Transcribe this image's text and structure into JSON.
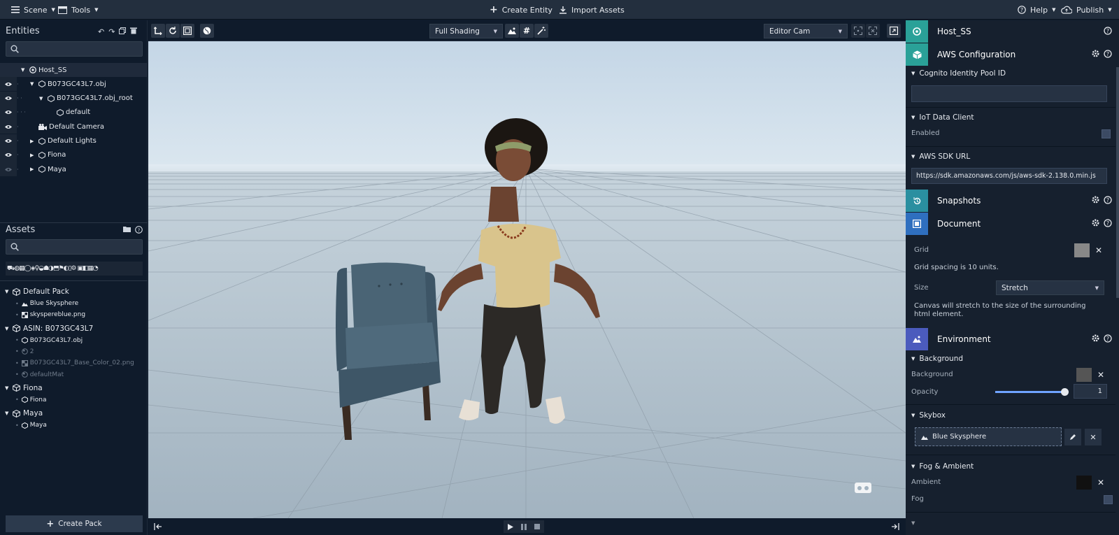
{
  "topbar": {
    "scene_label": "Scene",
    "tools_label": "Tools",
    "create_entity_label": "Create Entity",
    "import_assets_label": "Import Assets",
    "help_label": "Help",
    "publish_label": "Publish"
  },
  "entities": {
    "title": "Entities",
    "search_placeholder": "",
    "rows": [
      {
        "label": "Host_SS",
        "icon": "host-icon"
      },
      {
        "label": "B073GC43L7.obj",
        "icon": "mesh-icon"
      },
      {
        "label": "B073GC43L7.obj_root",
        "icon": "mesh-icon"
      },
      {
        "label": "default",
        "icon": "mesh-icon"
      },
      {
        "label": "Default Camera",
        "icon": "camera-icon"
      },
      {
        "label": "Default Lights",
        "icon": "mesh-icon"
      },
      {
        "label": "Fiona",
        "icon": "mesh-icon"
      },
      {
        "label": "Maya",
        "icon": "mesh-icon"
      }
    ]
  },
  "assets": {
    "title": "Assets",
    "search_placeholder": "",
    "groups": [
      {
        "label": "Default Pack",
        "items": [
          {
            "label": "Blue Skysphere",
            "icon": "skybox-icon",
            "dim": false
          },
          {
            "label": "skyspereblue.png",
            "icon": "texture-icon",
            "dim": false
          }
        ]
      },
      {
        "label": "ASIN: B073GC43L7",
        "items": [
          {
            "label": "B073GC43L7.obj",
            "icon": "mesh-icon",
            "dim": false
          },
          {
            "label": "2",
            "icon": "material-icon",
            "dim": true
          },
          {
            "label": "B073GC43L7_Base_Color_02.png",
            "icon": "texture-icon",
            "dim": true
          },
          {
            "label": "defaultMat",
            "icon": "material-icon",
            "dim": true
          }
        ]
      },
      {
        "label": "Fiona",
        "items": [
          {
            "label": "Fiona",
            "icon": "mesh-icon",
            "dim": false
          }
        ]
      },
      {
        "label": "Maya",
        "items": [
          {
            "label": "Maya",
            "icon": "mesh-icon",
            "dim": false
          }
        ]
      }
    ],
    "create_pack_label": "Create Pack"
  },
  "viewport": {
    "shading_label": "Full Shading",
    "camera_label": "Editor Cam"
  },
  "inspector": {
    "entity_name": "Host_SS",
    "aws_config_title": "AWS Configuration",
    "cognito_label": "Cognito Identity Pool ID",
    "cognito_value": "",
    "iot_label": "IoT Data Client",
    "enabled_label": "Enabled",
    "sdk_label": "AWS SDK URL",
    "sdk_value": "https://sdk.amazonaws.com/js/aws-sdk-2.138.0.min.js",
    "snapshots_title": "Snapshots",
    "document_title": "Document",
    "grid_label": "Grid",
    "grid_note": "Grid spacing is 10 units.",
    "size_label": "Size",
    "size_value": "Stretch",
    "size_note": "Canvas will stretch to the size of the surrounding html element.",
    "environment_title": "Environment",
    "background_section": "Background",
    "background_label": "Background",
    "opacity_label": "Opacity",
    "opacity_value": "1",
    "opacity_fraction": 1.0,
    "skybox_section": "Skybox",
    "skybox_value": "Blue Skysphere",
    "fog_section": "Fog & Ambient",
    "ambient_label": "Ambient",
    "fog_label": "Fog"
  },
  "colors": {
    "teal": "#2aa198",
    "blue": "#2f6fbf",
    "purple": "#4b5bbd",
    "grid_swatch": "#888888",
    "background_swatch": "#555555",
    "ambient_swatch": "#111111"
  }
}
